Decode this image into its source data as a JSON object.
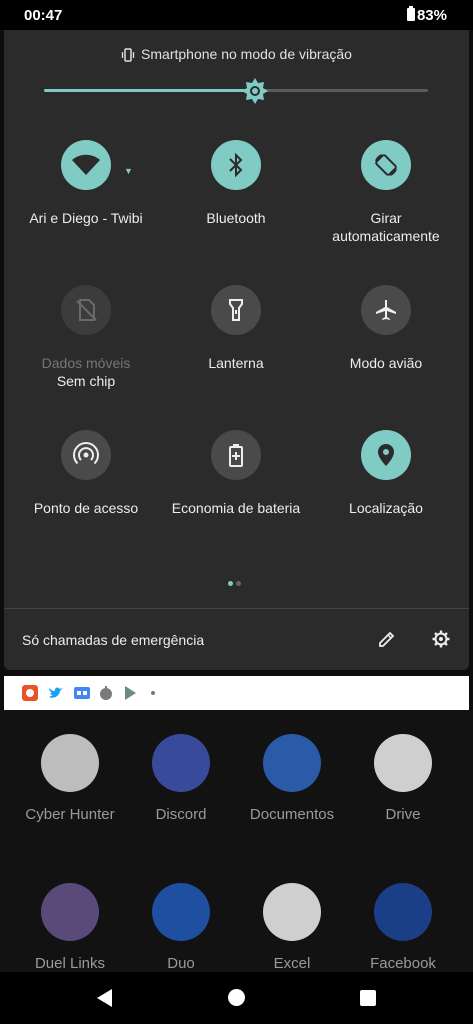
{
  "status_bar": {
    "time": "00:47",
    "battery": "83%"
  },
  "quick_settings": {
    "ringer_text": "Smartphone no modo de vibração",
    "brightness_level": 0.55,
    "tiles": [
      {
        "label": "Ari e Diego - Twibi",
        "state": "on",
        "icon": "wifi-icon"
      },
      {
        "label": "Bluetooth",
        "state": "on",
        "icon": "bluetooth-icon"
      },
      {
        "label": "Girar",
        "label2": "automaticamente",
        "state": "on",
        "icon": "auto-rotate-icon"
      },
      {
        "label": "Dados móveis",
        "label2": "Sem chip",
        "state": "disabled",
        "icon": "no-sim-icon"
      },
      {
        "label": "Lanterna",
        "state": "off",
        "icon": "flashlight-icon"
      },
      {
        "label": "Modo avião",
        "state": "off",
        "icon": "airplane-icon"
      },
      {
        "label": "Ponto de acesso",
        "state": "off",
        "icon": "hotspot-icon"
      },
      {
        "label": "Economia de bateria",
        "state": "off",
        "icon": "battery-saver-icon"
      },
      {
        "label": "Localização",
        "state": "on",
        "icon": "location-icon"
      }
    ],
    "page_dots": {
      "count": 2,
      "active": 0
    },
    "footer_text": "Só chamadas de emergência"
  },
  "notification_icons": [
    "app-notification-icon",
    "twitter-icon",
    "translate-icon",
    "app-notification-icon",
    "play-store-icon",
    "more-dot-icon"
  ],
  "apps": [
    {
      "label": "Cyber Hunter",
      "color": "#bdbdbd"
    },
    {
      "label": "Discord",
      "color": "#3a4a9b"
    },
    {
      "label": "Documentos",
      "color": "#2b5aa8"
    },
    {
      "label": "Drive",
      "color": "#cfcfcf"
    },
    {
      "label": "Duel Links",
      "color": "#5a4a7a"
    },
    {
      "label": "Duo",
      "color": "#1e4fa0"
    },
    {
      "label": "Excel",
      "color": "#cfcfcf"
    },
    {
      "label": "Facebook",
      "color": "#1b3f86"
    }
  ],
  "colors": {
    "accent": "#80cbc4",
    "panel": "#2b2b2b",
    "tile_off": "#4a4a4a"
  }
}
